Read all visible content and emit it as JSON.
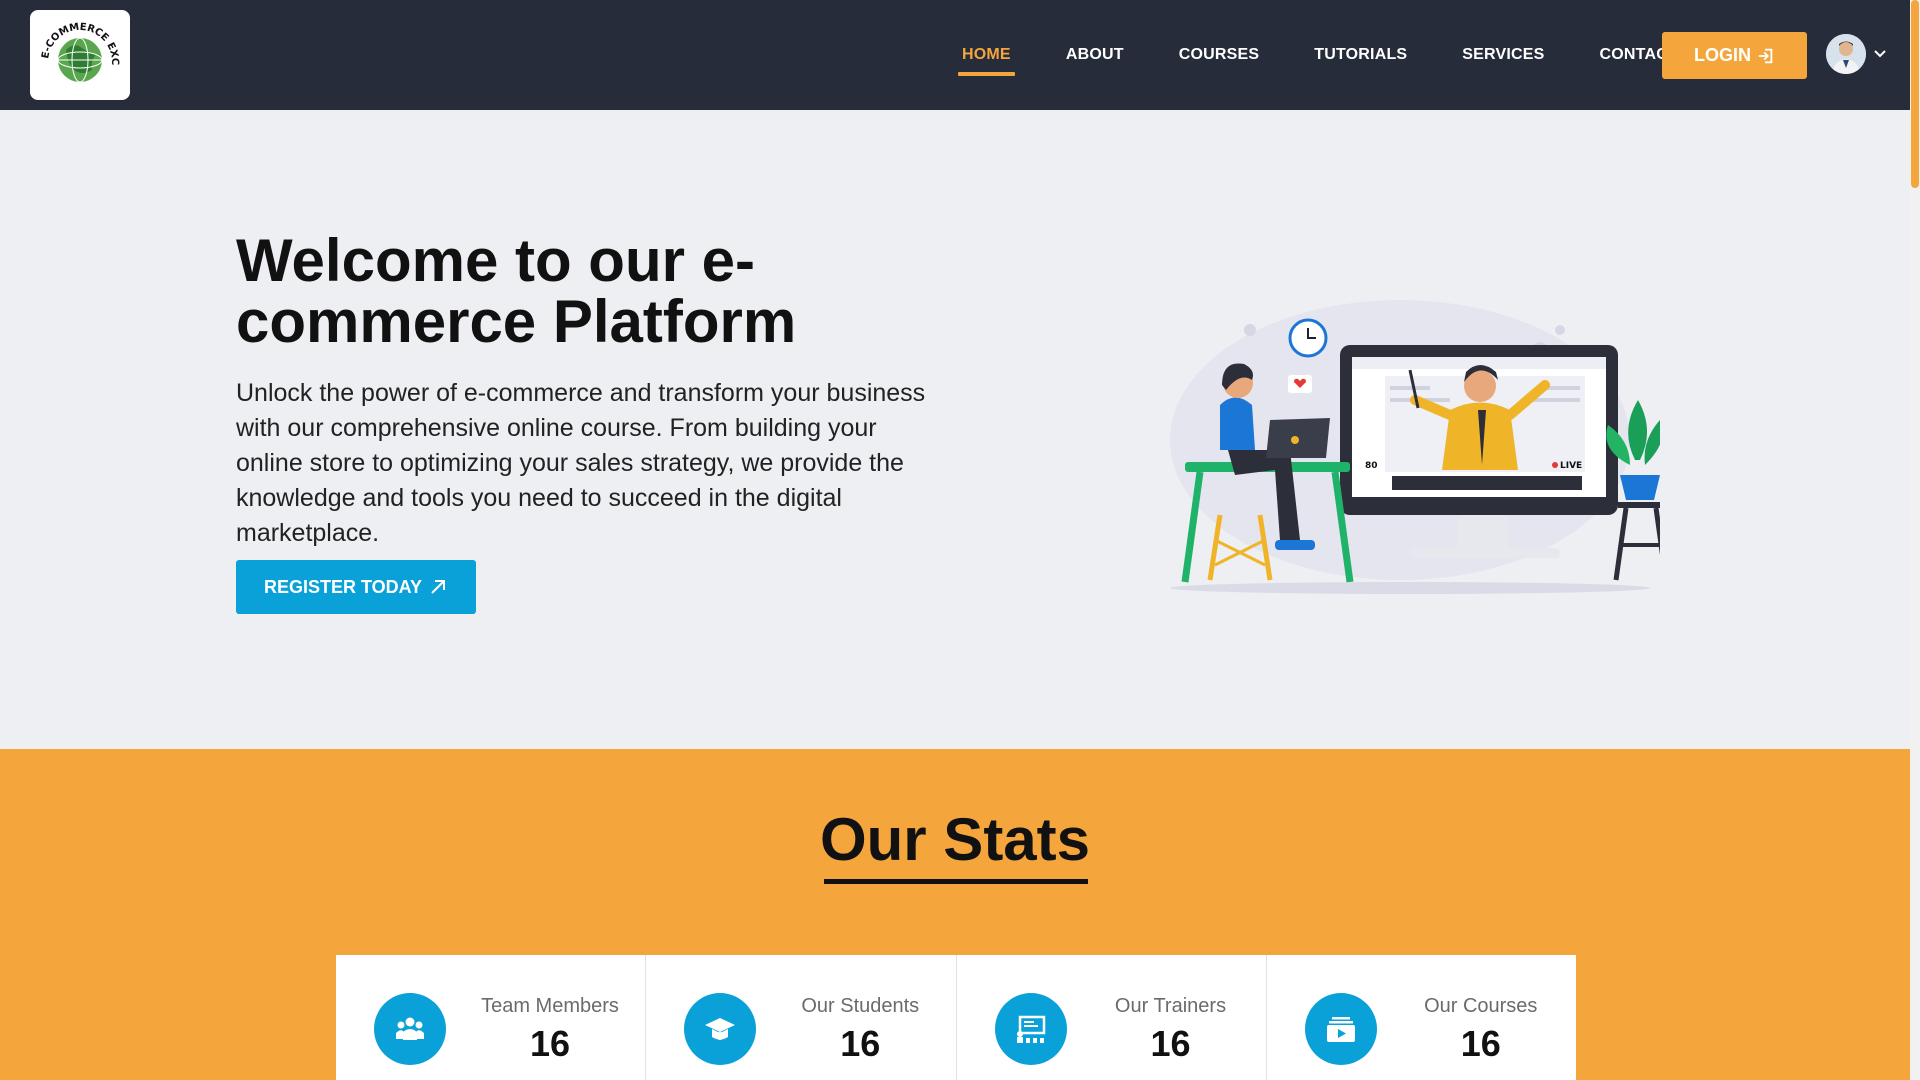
{
  "header": {
    "logo_alt": "E-COMMERCE EXCEL",
    "nav": [
      {
        "label": "HOME",
        "active": true
      },
      {
        "label": "ABOUT",
        "active": false
      },
      {
        "label": "COURSES",
        "active": false
      },
      {
        "label": "TUTORIALS",
        "active": false
      },
      {
        "label": "SERVICES",
        "active": false
      },
      {
        "label": "CONTACT",
        "active": false
      }
    ],
    "login_label": "LOGIN"
  },
  "hero": {
    "title": "Welcome to our e-commerce Platform",
    "text": "Unlock the power of e-commerce and transform your business with our comprehensive online course. From building your online store to optimizing your sales strategy, we provide the knowledge and tools you need to succeed in the digital marketplace.",
    "register_label": "REGISTER TODAY",
    "illustration": {
      "viewer_count": "80",
      "live_label": "LIVE"
    }
  },
  "stats": {
    "title": "Our Stats",
    "items": [
      {
        "label": "Team Members",
        "value": "16",
        "icon": "team-icon"
      },
      {
        "label": "Our Students",
        "value": "16",
        "icon": "graduation-cap-icon"
      },
      {
        "label": "Our Trainers",
        "value": "16",
        "icon": "presentation-icon"
      },
      {
        "label": "Our Courses",
        "value": "16",
        "icon": "video-play-icon"
      }
    ]
  },
  "colors": {
    "header_bg": "#262c3a",
    "accent_orange": "#f4a63d",
    "accent_blue": "#0aa1d8",
    "hero_bg": "#eeeff3"
  }
}
